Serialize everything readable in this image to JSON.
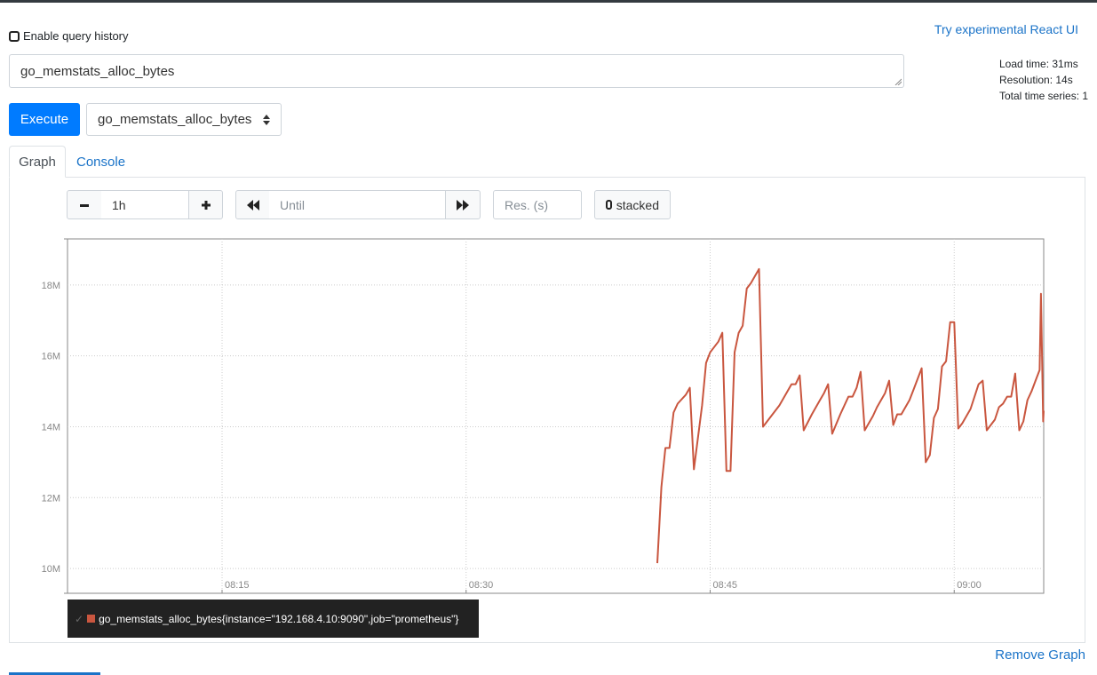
{
  "history": {
    "label": "Enable query history",
    "checked": false
  },
  "react_link": "Try experimental React UI",
  "stats": {
    "load_time": "Load time: 31ms",
    "resolution": "Resolution: 14s",
    "total_series": "Total time series: 1"
  },
  "query": {
    "value": "go_memstats_alloc_bytes"
  },
  "execute_label": "Execute",
  "metric_select": {
    "selected": "go_memstats_alloc_bytes"
  },
  "tabs": [
    {
      "label": "Graph",
      "active": true
    },
    {
      "label": "Console",
      "active": false
    }
  ],
  "controls": {
    "range_value": "1h",
    "until_placeholder": "Until",
    "res_placeholder": "Res. (s)",
    "stacked_label": "stacked"
  },
  "chart_data": {
    "type": "line",
    "y_ticks": [
      "10M",
      "12M",
      "14M",
      "16M",
      "18M"
    ],
    "x_ticks": [
      "08:15",
      "08:30",
      "08:45",
      "09:00"
    ],
    "ylim": [
      9.3,
      19.3
    ],
    "y_unit_scale": 1000000,
    "xlim": [
      "08:05:30",
      "09:05:30"
    ],
    "grid": true,
    "series": [
      {
        "name": "go_memstats_alloc_bytes{instance=\"192.168.4.10:9090\",job=\"prometheus\"}",
        "color": "#c9563f",
        "points": [
          [
            "08:41:45",
            10.15
          ],
          [
            "08:42:00",
            12.3
          ],
          [
            "08:42:15",
            13.4
          ],
          [
            "08:42:30",
            13.4
          ],
          [
            "08:42:45",
            14.4
          ],
          [
            "08:43:00",
            14.65
          ],
          [
            "08:43:30",
            14.9
          ],
          [
            "08:43:45",
            15.1
          ],
          [
            "08:44:00",
            12.8
          ],
          [
            "08:44:30",
            14.6
          ],
          [
            "08:44:45",
            15.8
          ],
          [
            "08:45:00",
            16.1
          ],
          [
            "08:45:15",
            16.25
          ],
          [
            "08:45:30",
            16.4
          ],
          [
            "08:45:45",
            16.65
          ],
          [
            "08:46:00",
            12.75
          ],
          [
            "08:46:15",
            12.75
          ],
          [
            "08:46:30",
            16.1
          ],
          [
            "08:46:45",
            16.65
          ],
          [
            "08:47:00",
            16.85
          ],
          [
            "08:47:15",
            17.9
          ],
          [
            "08:47:30",
            18.05
          ],
          [
            "08:48:00",
            18.45
          ],
          [
            "08:48:15",
            14.0
          ],
          [
            "08:48:45",
            14.3
          ],
          [
            "08:49:15",
            14.6
          ],
          [
            "08:49:45",
            15.0
          ],
          [
            "08:50:00",
            15.2
          ],
          [
            "08:50:15",
            15.2
          ],
          [
            "08:50:30",
            15.45
          ],
          [
            "08:50:45",
            13.9
          ],
          [
            "08:51:15",
            14.35
          ],
          [
            "08:51:45",
            14.75
          ],
          [
            "08:52:00",
            14.95
          ],
          [
            "08:52:15",
            15.2
          ],
          [
            "08:52:30",
            13.8
          ],
          [
            "08:53:00",
            14.35
          ],
          [
            "08:53:30",
            14.85
          ],
          [
            "08:53:45",
            14.85
          ],
          [
            "08:54:00",
            15.1
          ],
          [
            "08:54:15",
            15.55
          ],
          [
            "08:54:30",
            13.9
          ],
          [
            "08:55:00",
            14.3
          ],
          [
            "08:55:15",
            14.55
          ],
          [
            "08:55:45",
            14.95
          ],
          [
            "08:56:00",
            15.3
          ],
          [
            "08:56:15",
            14.05
          ],
          [
            "08:56:30",
            14.35
          ],
          [
            "08:56:45",
            14.35
          ],
          [
            "08:57:00",
            14.55
          ],
          [
            "08:57:15",
            14.75
          ],
          [
            "08:57:30",
            15.05
          ],
          [
            "08:58:00",
            15.65
          ],
          [
            "08:58:15",
            13.0
          ],
          [
            "08:58:30",
            13.2
          ],
          [
            "08:58:45",
            14.25
          ],
          [
            "08:59:00",
            14.5
          ],
          [
            "08:59:15",
            15.7
          ],
          [
            "08:59:30",
            15.85
          ],
          [
            "08:59:45",
            16.95
          ],
          [
            "09:00:00",
            16.95
          ],
          [
            "09:00:15",
            13.95
          ],
          [
            "09:00:30",
            14.1
          ],
          [
            "09:01:00",
            14.5
          ],
          [
            "09:01:30",
            15.2
          ],
          [
            "09:01:45",
            15.3
          ],
          [
            "09:02:00",
            13.9
          ],
          [
            "09:02:30",
            14.2
          ],
          [
            "09:02:45",
            14.55
          ],
          [
            "09:03:00",
            14.65
          ],
          [
            "09:03:15",
            14.85
          ],
          [
            "09:03:30",
            14.85
          ],
          [
            "09:03:45",
            15.5
          ],
          [
            "09:04:00",
            13.9
          ],
          [
            "09:04:15",
            14.15
          ],
          [
            "09:04:30",
            14.75
          ],
          [
            "09:04:45",
            15.0
          ],
          [
            "09:05:00",
            15.3
          ],
          [
            "09:05:15",
            15.6
          ],
          [
            "09:05:20",
            17.75
          ],
          [
            "09:05:28",
            14.15
          ],
          [
            "09:05:30",
            14.45
          ]
        ]
      }
    ]
  },
  "legend": {
    "text": "go_memstats_alloc_bytes{instance=\"192.168.4.10:9090\",job=\"prometheus\"}"
  },
  "remove_graph_label": "Remove Graph"
}
